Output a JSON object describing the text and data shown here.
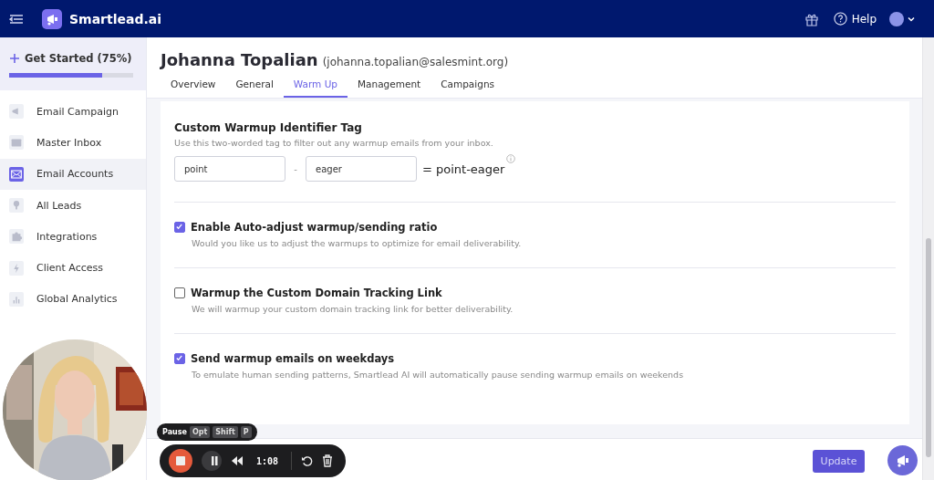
{
  "header": {
    "brand": "Smartlead.ai",
    "help": "Help"
  },
  "get_started": {
    "label": "Get Started (75%)",
    "level": 0.75
  },
  "sidebar": {
    "items": [
      {
        "label": "Email Campaign",
        "kind": "megaphone",
        "selected": false
      },
      {
        "label": "Master Inbox",
        "kind": "inbox",
        "selected": false
      },
      {
        "label": "Email Accounts",
        "kind": "envelope",
        "selected": true
      },
      {
        "label": "All Leads",
        "kind": "bulb",
        "selected": false
      },
      {
        "label": "Integrations",
        "kind": "puzzle",
        "selected": false
      },
      {
        "label": "Client Access",
        "kind": "bolt",
        "selected": false
      },
      {
        "label": "Global Analytics",
        "kind": "chart",
        "selected": false
      }
    ]
  },
  "account": {
    "name": "Johanna Topalian",
    "email": "(johanna.topalian@salesmint.org)"
  },
  "tabs": [
    {
      "label": "Overview",
      "selected": false
    },
    {
      "label": "General",
      "selected": false
    },
    {
      "label": "Warm Up",
      "selected": true
    },
    {
      "label": "Management",
      "selected": false
    },
    {
      "label": "Campaigns",
      "selected": false
    }
  ],
  "tag_section": {
    "title": "Custom Warmup Identifier Tag",
    "description": "Use this two-worded tag to filter out any warmup emails from your inbox.",
    "first_word": "point",
    "separator": "-",
    "second_word": "eager",
    "result": "= point-eager"
  },
  "options": [
    {
      "label": "Enable Auto-adjust warmup/sending ratio",
      "description": "Would you like us to adjust the warmups to optimize for email deliverability.",
      "checked": true
    },
    {
      "label": "Warmup the Custom Domain Tracking Link",
      "description": "We will warmup your custom domain tracking link for better deliverability.",
      "checked": false
    },
    {
      "label": "Send warmup emails on weekdays",
      "description": "To emulate human sending patterns, Smartlead AI will automatically pause sending warmup emails on weekends",
      "checked": true
    }
  ],
  "update_button": "Update",
  "recorder": {
    "shortcut_label": "Pause",
    "keys": [
      "Opt",
      "Shift",
      "P"
    ],
    "time": "1:08"
  }
}
